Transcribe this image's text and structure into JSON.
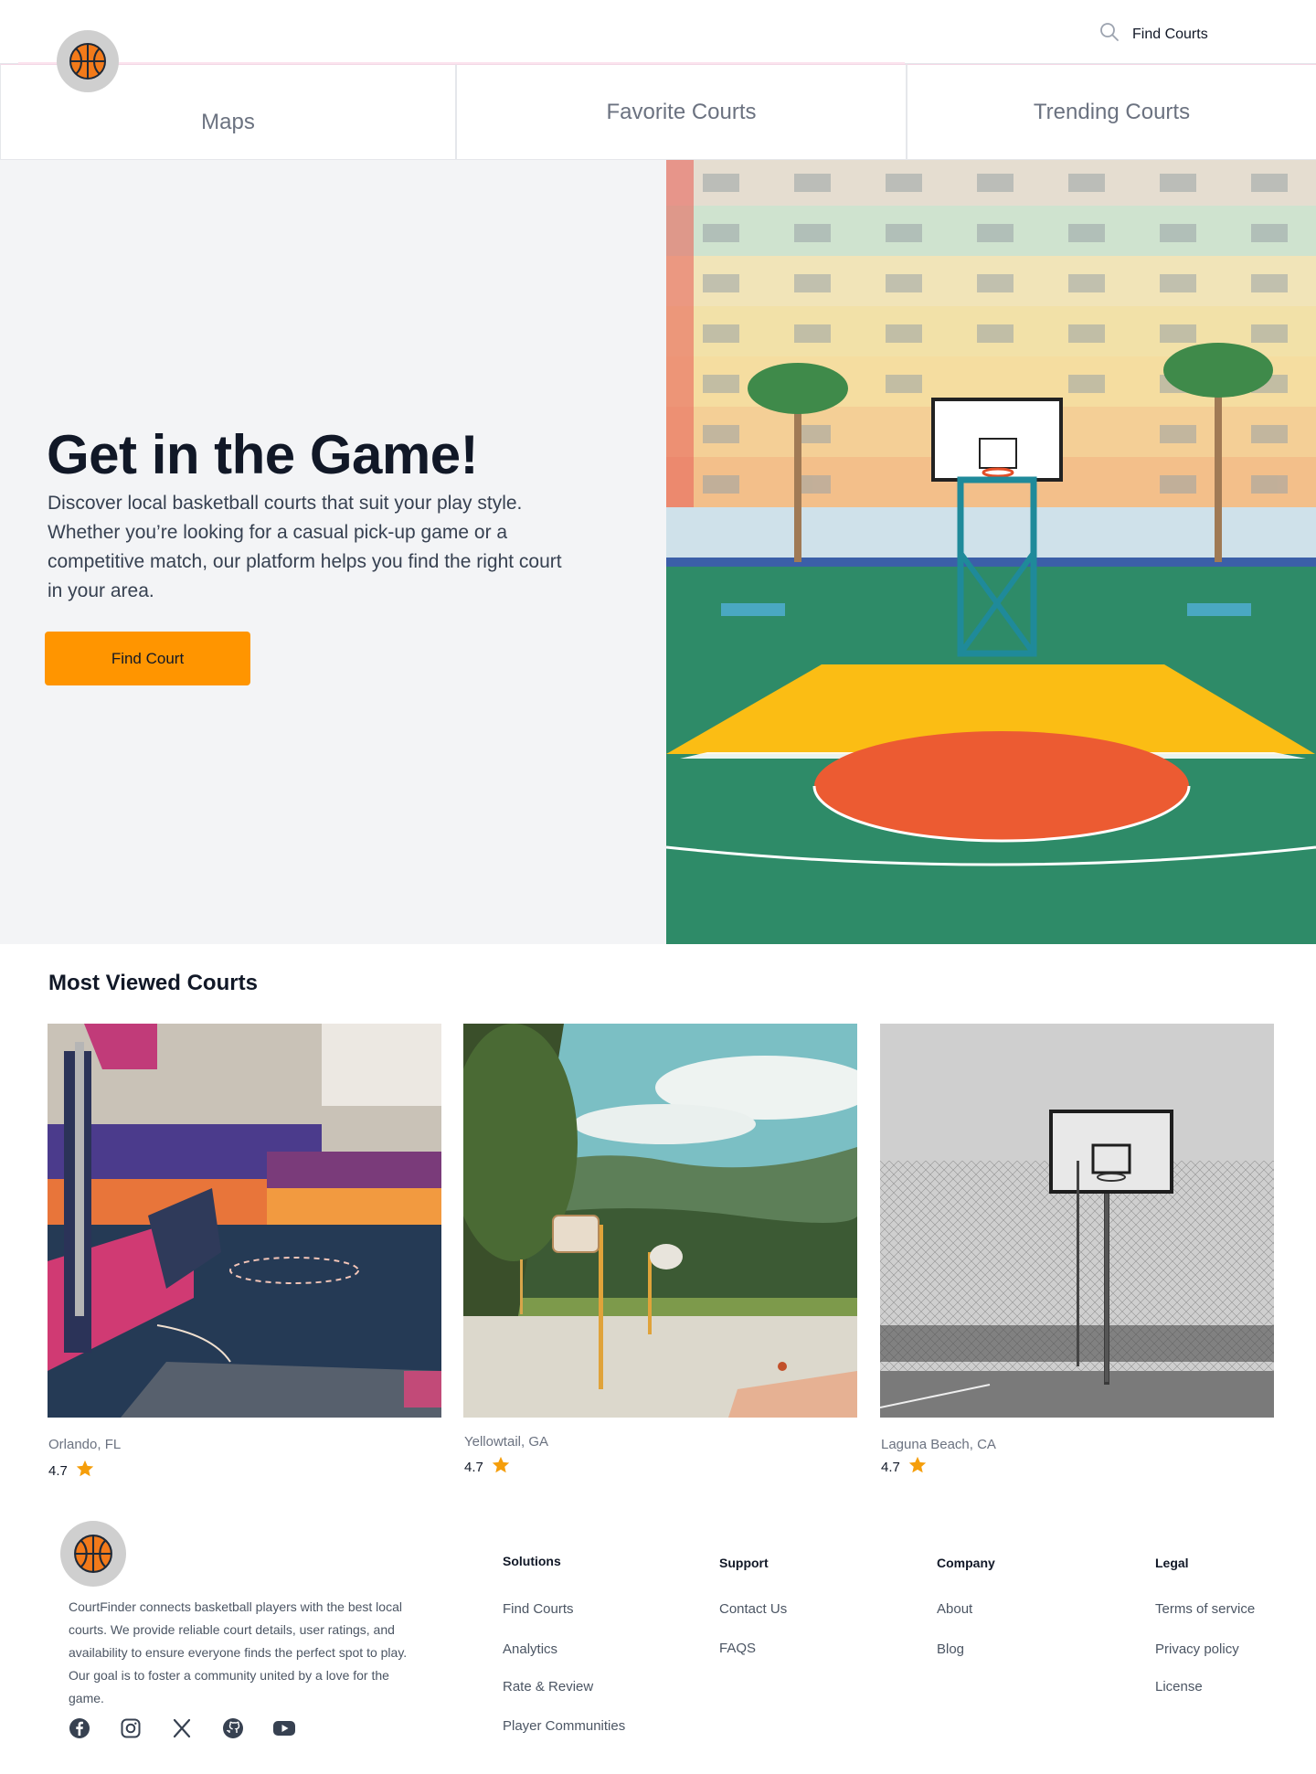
{
  "header": {
    "search_label": "Find Courts"
  },
  "tabs": [
    {
      "label": "Maps"
    },
    {
      "label": "Favorite Courts"
    },
    {
      "label": "Trending Courts"
    }
  ],
  "hero": {
    "title": "Get in the Game!",
    "description": "Discover local basketball courts that suit your play style. Whether you’re looking for a casual pick-up game or a competitive match, our platform helps you find the right court in your area.",
    "button_label": "Find Court"
  },
  "most_viewed": {
    "title": "Most Viewed Courts",
    "cards": [
      {
        "location": "Orlando, FL",
        "rating": "4.7"
      },
      {
        "location": "Yellowtail, GA",
        "rating": "4.7"
      },
      {
        "location": "Laguna Beach, CA",
        "rating": "4.7"
      }
    ]
  },
  "footer": {
    "description": "CourtFinder connects basketball players with the best local courts. We provide reliable court details, user ratings, and availability to ensure everyone finds the perfect spot to play. Our goal is to foster a community united by a love for the game.",
    "columns": [
      {
        "title": "Solutions",
        "links": [
          "Find Courts",
          "Analytics",
          "Rate & Review",
          "Player Communities"
        ]
      },
      {
        "title": "Support",
        "links": [
          "Contact Us",
          "FAQS"
        ]
      },
      {
        "title": "Company",
        "links": [
          "About",
          "Blog"
        ]
      },
      {
        "title": "Legal",
        "links": [
          "Terms of service",
          "Privacy policy",
          "License"
        ]
      }
    ],
    "socials": [
      "facebook-icon",
      "instagram-icon",
      "x-icon",
      "github-icon",
      "youtube-icon"
    ]
  },
  "colors": {
    "accent": "#ff9500",
    "star": "#f59e0b",
    "hero_bg": "#f3f4f6",
    "text_dark": "#111827",
    "text_muted": "#6b7280"
  }
}
